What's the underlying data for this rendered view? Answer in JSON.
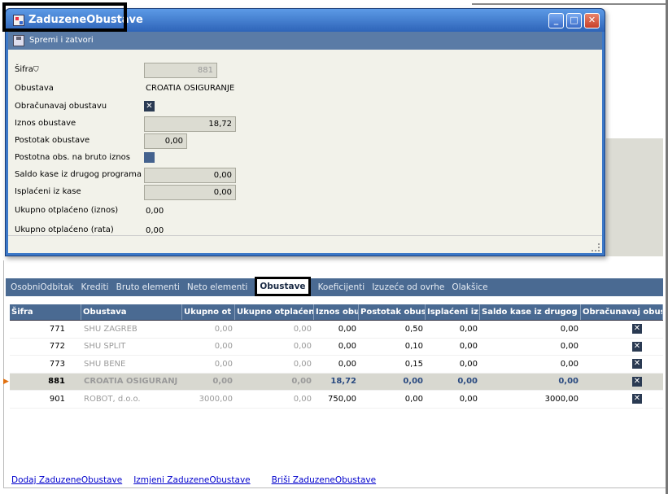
{
  "dialog": {
    "title": "ZaduzeneObustave",
    "toolbar_label": "Spremi i zatvori",
    "fields": {
      "sifra_label": "Šifra",
      "sifra_value": "881",
      "obustava_label": "Obustava",
      "obustava_value": "CROATIA OSIGURANJE",
      "obracunavaj_label": "Obračunavaj obustavu",
      "iznos_label": "Iznos obustave",
      "iznos_value": "18,72",
      "postotak_label": "Postotak obustave",
      "postotak_value": "0,00",
      "postotna_label": "Postotna obs. na bruto iznos",
      "saldo_label": "Saldo kase iz drugog programa",
      "saldo_value": "0,00",
      "isplaceni_label": "Isplaćeni iz kase",
      "isplaceni_value": "0,00",
      "ukupno_iznos_label": "Ukupno otplaćeno (iznos)",
      "ukupno_iznos_value": "0,00",
      "ukupno_rata_label": "Ukupno otplaćeno (rata)",
      "ukupno_rata_value": "0,00"
    }
  },
  "tabs": [
    "OsobniOdbitak",
    "Krediti",
    "Bruto elementi",
    "Neto elementi",
    "Obustave",
    "Koeficijenti",
    "Izuzeće od ovrhe",
    "Olakšice"
  ],
  "grid": {
    "headers": [
      "Šifra",
      "Obustava",
      "Ukupno ot",
      "Ukupno otplaćen",
      "Iznos obu",
      "Postotak obus",
      "Isplaćeni iz",
      "Saldo kase iz drugog p",
      "Obračunavaj obust"
    ],
    "rows": [
      {
        "sifra": "771",
        "obustava": "SHU ZAGREB",
        "ukupno_ot": "0,00",
        "ukupno_otpl": "0,00",
        "iznos": "0,00",
        "postotak": "0,50",
        "isplaceni": "0,00",
        "saldo": "0,00"
      },
      {
        "sifra": "772",
        "obustava": "SHU SPLIT",
        "ukupno_ot": "0,00",
        "ukupno_otpl": "0,00",
        "iznos": "0,00",
        "postotak": "0,10",
        "isplaceni": "0,00",
        "saldo": "0,00"
      },
      {
        "sifra": "773",
        "obustava": "SHU BENE",
        "ukupno_ot": "0,00",
        "ukupno_otpl": "0,00",
        "iznos": "0,00",
        "postotak": "0,15",
        "isplaceni": "0,00",
        "saldo": "0,00"
      },
      {
        "sifra": "881",
        "obustava": "CROATIA OSIGURANJ",
        "ukupno_ot": "0,00",
        "ukupno_otpl": "0,00",
        "iznos": "18,72",
        "postotak": "0,00",
        "isplaceni": "0,00",
        "saldo": "0,00"
      },
      {
        "sifra": "901",
        "obustava": "ROBOT, d.o.o.",
        "ukupno_ot": "3000,00",
        "ukupno_otpl": "0,00",
        "iznos": "750,00",
        "postotak": "0,00",
        "isplaceni": "0,00",
        "saldo": "3000,00"
      }
    ]
  },
  "links": {
    "add": "Dodaj ZaduzeneObustave",
    "edit": "Izmjeni ZaduzeneObustave",
    "delete": "Briši ZaduzeneObustave"
  },
  "icons": {
    "checkbox_mark": "✕",
    "row_indicator": "▶",
    "minimize": "_",
    "maximize": "□",
    "close": "✕"
  },
  "colors": {
    "header_bg": "#4a6a92",
    "title_bar": "#3c78c8",
    "close_button": "#c8402a"
  }
}
